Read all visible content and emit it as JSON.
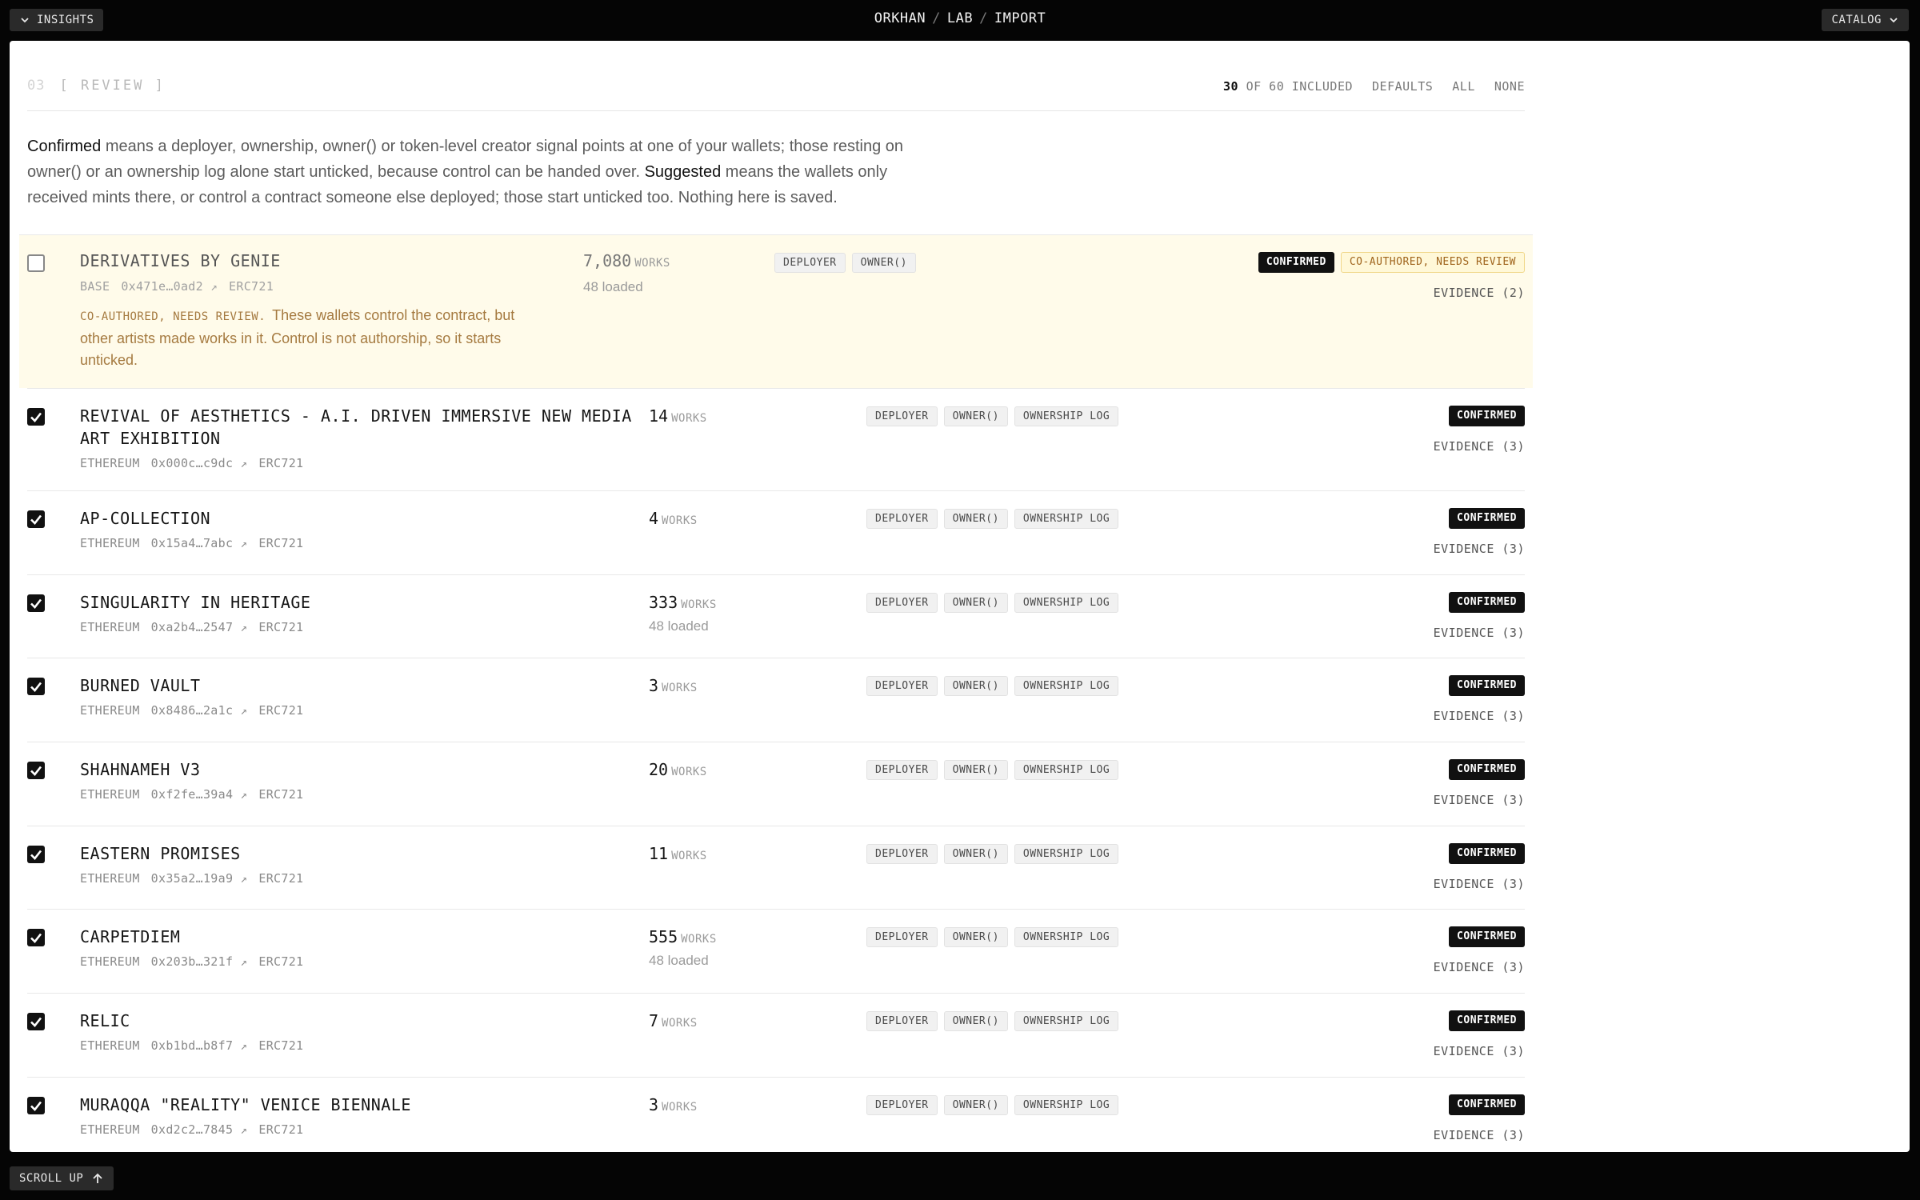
{
  "topbar": {
    "insights_label": "INSIGHTS",
    "catalog_label": "CATALOG",
    "breadcrumb": [
      "ORKHAN",
      "LAB",
      "IMPORT"
    ],
    "breadcrumb_separator": "/"
  },
  "section": {
    "step_number": "03",
    "step_title": "[ REVIEW ]",
    "included_count": "30",
    "included_rest": "OF 60 INCLUDED",
    "actions": [
      "DEFAULTS",
      "ALL",
      "NONE"
    ]
  },
  "intro": {
    "term_confirmed": "Confirmed",
    "text_confirmed": " means a deployer, ownership, owner() or token-level creator signal points at one of your wallets; those resting on owner() or an ownership log alone start unticked, because control can be handed over. ",
    "term_suggested": "Suggested",
    "text_suggested": " means the wallets only received mints there, or control a contract someone else deployed; those start unticked too. Nothing here is saved."
  },
  "works_unit": "WORKS",
  "rows": [
    {
      "name": "DERIVATIVES BY GENIE",
      "chain": "BASE",
      "address": "0x471e…0ad2",
      "standard": "ERC721",
      "checked": false,
      "works": "7,080",
      "loaded": "48 loaded",
      "signals": [
        "DEPLOYER",
        "OWNER()"
      ],
      "badges": [
        "CONFIRMED",
        "CO-AUTHORED, NEEDS REVIEW"
      ],
      "evidence": "EVIDENCE (2)",
      "note_tag": "CO-AUTHORED, NEEDS REVIEW.",
      "note_text": "These wallets control the contract, but other artists made works in it. Control is not authorship, so it starts unticked."
    },
    {
      "name": "REVIVAL OF AESTHETICS - A.I. DRIVEN IMMERSIVE NEW MEDIA ART EXHIBITION",
      "chain": "ETHEREUM",
      "address": "0x000c…c9dc",
      "standard": "ERC721",
      "checked": true,
      "works": "14",
      "loaded": "",
      "signals": [
        "DEPLOYER",
        "OWNER()",
        "OWNERSHIP LOG"
      ],
      "badges": [
        "CONFIRMED"
      ],
      "evidence": "EVIDENCE (3)"
    },
    {
      "name": "AP-COLLECTION",
      "chain": "ETHEREUM",
      "address": "0x15a4…7abc",
      "standard": "ERC721",
      "checked": true,
      "works": "4",
      "loaded": "",
      "signals": [
        "DEPLOYER",
        "OWNER()",
        "OWNERSHIP LOG"
      ],
      "badges": [
        "CONFIRMED"
      ],
      "evidence": "EVIDENCE (3)"
    },
    {
      "name": "SINGULARITY IN HERITAGE",
      "chain": "ETHEREUM",
      "address": "0xa2b4…2547",
      "standard": "ERC721",
      "checked": true,
      "works": "333",
      "loaded": "48 loaded",
      "signals": [
        "DEPLOYER",
        "OWNER()",
        "OWNERSHIP LOG"
      ],
      "badges": [
        "CONFIRMED"
      ],
      "evidence": "EVIDENCE (3)"
    },
    {
      "name": "BURNED VAULT",
      "chain": "ETHEREUM",
      "address": "0x8486…2a1c",
      "standard": "ERC721",
      "checked": true,
      "works": "3",
      "loaded": "",
      "signals": [
        "DEPLOYER",
        "OWNER()",
        "OWNERSHIP LOG"
      ],
      "badges": [
        "CONFIRMED"
      ],
      "evidence": "EVIDENCE (3)"
    },
    {
      "name": "SHAHNAMEH V3",
      "chain": "ETHEREUM",
      "address": "0xf2fe…39a4",
      "standard": "ERC721",
      "checked": true,
      "works": "20",
      "loaded": "",
      "signals": [
        "DEPLOYER",
        "OWNER()",
        "OWNERSHIP LOG"
      ],
      "badges": [
        "CONFIRMED"
      ],
      "evidence": "EVIDENCE (3)"
    },
    {
      "name": "EASTERN PROMISES",
      "chain": "ETHEREUM",
      "address": "0x35a2…19a9",
      "standard": "ERC721",
      "checked": true,
      "works": "11",
      "loaded": "",
      "signals": [
        "DEPLOYER",
        "OWNER()",
        "OWNERSHIP LOG"
      ],
      "badges": [
        "CONFIRMED"
      ],
      "evidence": "EVIDENCE (3)"
    },
    {
      "name": "CARPETDIEM",
      "chain": "ETHEREUM",
      "address": "0x203b…321f",
      "standard": "ERC721",
      "checked": true,
      "works": "555",
      "loaded": "48 loaded",
      "signals": [
        "DEPLOYER",
        "OWNER()",
        "OWNERSHIP LOG"
      ],
      "badges": [
        "CONFIRMED"
      ],
      "evidence": "EVIDENCE (3)"
    },
    {
      "name": "RELIC",
      "chain": "ETHEREUM",
      "address": "0xb1bd…b8f7",
      "standard": "ERC721",
      "checked": true,
      "works": "7",
      "loaded": "",
      "signals": [
        "DEPLOYER",
        "OWNER()",
        "OWNERSHIP LOG"
      ],
      "badges": [
        "CONFIRMED"
      ],
      "evidence": "EVIDENCE (3)"
    },
    {
      "name": "MURAQQA \"REALITY\" VENICE BIENNALE",
      "chain": "ETHEREUM",
      "address": "0xd2c2…7845",
      "standard": "ERC721",
      "checked": true,
      "works": "3",
      "loaded": "",
      "signals": [
        "DEPLOYER",
        "OWNER()",
        "OWNERSHIP LOG"
      ],
      "badges": [
        "CONFIRMED"
      ],
      "evidence": "EVIDENCE (3)"
    }
  ],
  "bottom": {
    "scroll_up_label": "SCROLL UP"
  },
  "icons": {
    "insights": "chevron-down-icon",
    "catalog": "chevron-down-icon",
    "scroll_up": "arrow-up-icon",
    "external": "arrow-up-right-icon",
    "checkbox": "checkmark-icon"
  },
  "colors": {
    "background": "#050505",
    "panel": "#ffffff",
    "flagged_row": "#fffbea",
    "confirmed_badge": "#111111",
    "warning_text": "#a0651d"
  }
}
